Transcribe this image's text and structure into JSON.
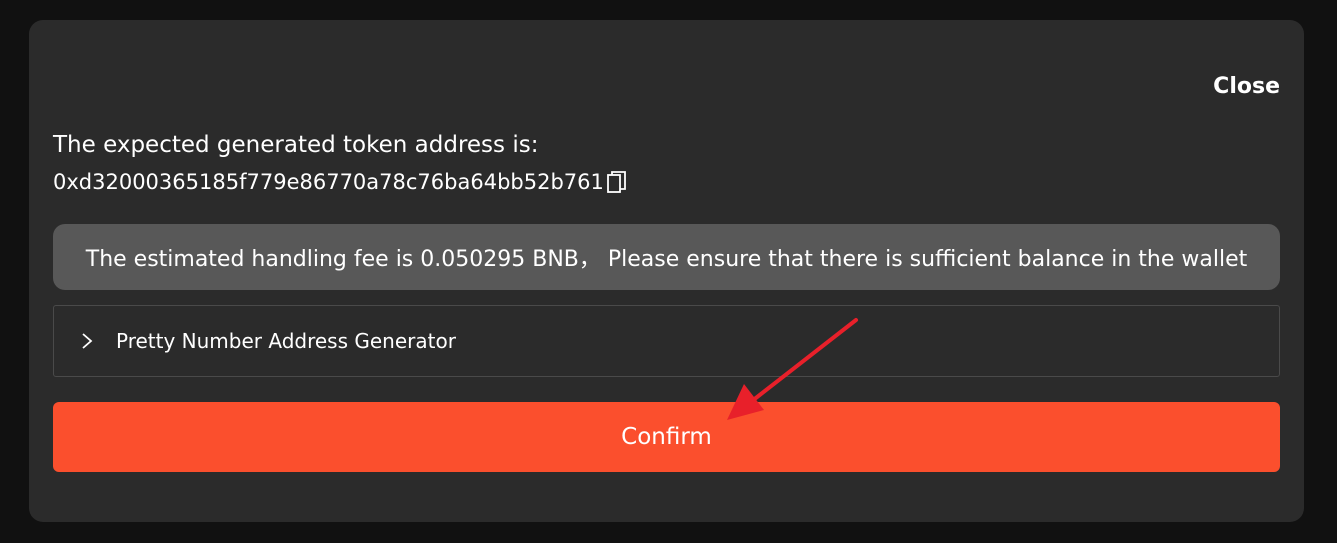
{
  "dialog": {
    "close_label": "Close",
    "address_label": "The expected generated token address is:",
    "address_value": "0xd32000365185f779e86770a78c76ba64bb52b761",
    "copy_icon": "copy-icon",
    "fee_notice": "The estimated handling fee is 0.050295 BNB， Please ensure that there is sufficient balance in the wallet",
    "generator_label": "Pretty Number Address Generator",
    "generator_expanded": false,
    "confirm_label": "Confirm"
  },
  "colors": {
    "background": "#111111",
    "modal": "#2b2b2b",
    "fee_box": "#585858",
    "confirm": "#fb4f2d",
    "annotation_arrow": "#e8202a"
  }
}
